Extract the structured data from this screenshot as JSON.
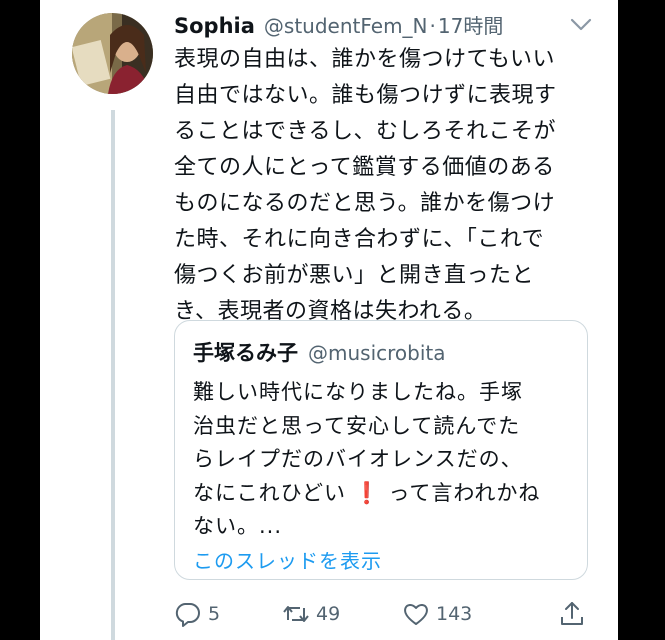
{
  "tweet": {
    "author_name": "Sophia",
    "author_handle": "@studentFem_N",
    "separator": "·",
    "timestamp": "17時間",
    "text": "表現の自由は、誰かを傷つけてもいい\n自由ではない。誰も傷つけずに表現す\nることはできるし、むしろそれこそが\n全ての人にとって鑑賞する価値のある\nものになるのだと思う。誰かを傷つけ\nた時、それに向き合わずに、「これで\n傷つくお前が悪い」と開き直ったと\nき、表現者の資格は失われる。"
  },
  "quoted": {
    "author_name": "手塚るみ子",
    "author_handle": "@musicrobita",
    "text_before": "難しい時代になりましたね。手塚\n治虫だと思って安心して読んでた\nらレイプだのバイオレンスだの、\nなにこれひどい",
    "emoji": "❗",
    "text_after": "って言われかね\nない。...",
    "show_thread": "このスレッドを表示"
  },
  "actions": {
    "reply_count": "5",
    "retweet_count": "49",
    "like_count": "143"
  },
  "icons": [
    "chevron-down-icon",
    "reply-icon",
    "retweet-icon",
    "like-icon",
    "share-icon"
  ],
  "colors": {
    "text": "#0f1419",
    "secondary": "#536471",
    "link": "#1d9bf0",
    "border": "#cfd9de",
    "emoji": "#dd1f26"
  }
}
